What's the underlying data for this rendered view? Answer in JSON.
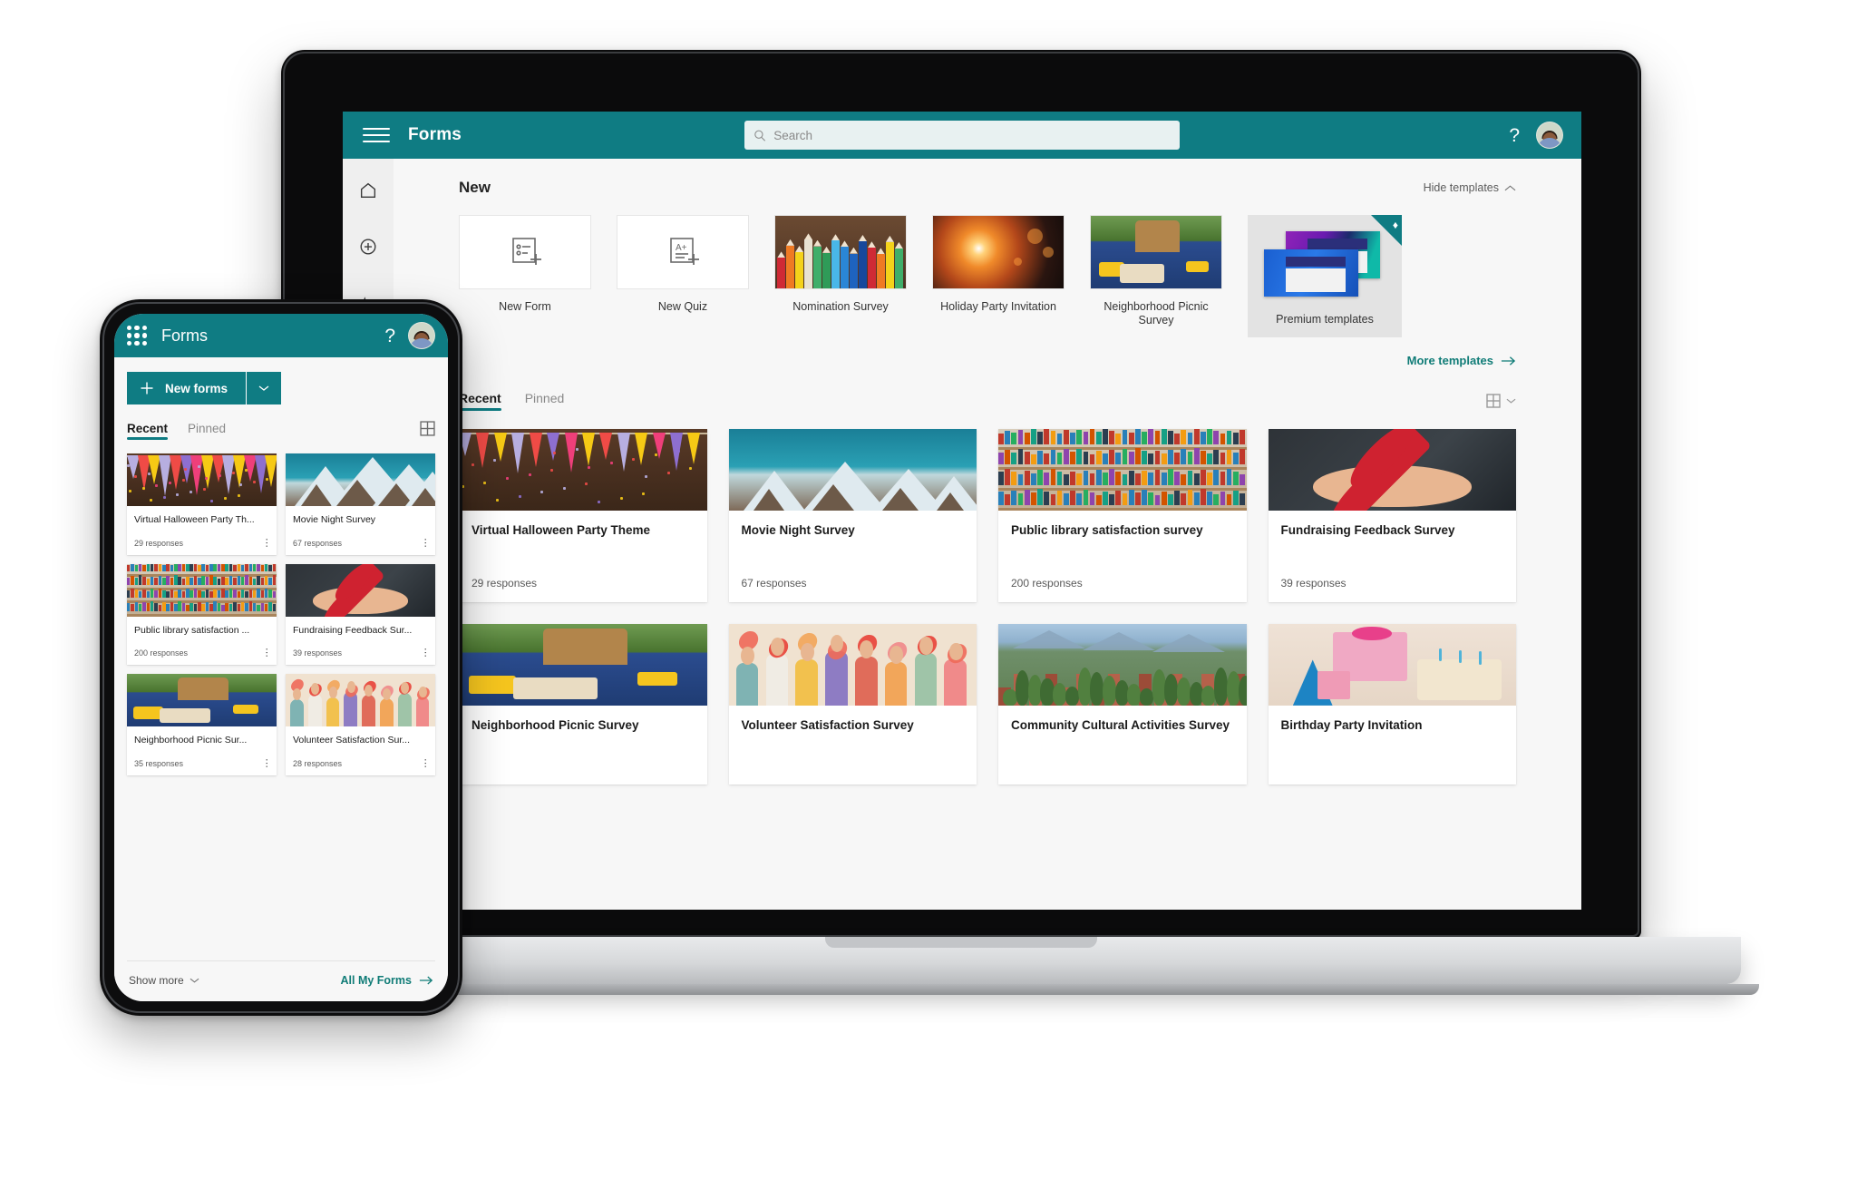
{
  "desktop": {
    "topbar": {
      "menu_icon": "hamburger-icon",
      "brand": "Forms",
      "search_placeholder": "Search",
      "search_value": "",
      "search_icon": "search-icon",
      "help_label": "?",
      "avatar_label": "Account manager"
    },
    "rail": [
      {
        "icon": "home-icon",
        "label": "Home"
      },
      {
        "icon": "plus-circle-icon",
        "label": "New"
      },
      {
        "icon": "activity-pulse-icon",
        "label": "Activity"
      }
    ],
    "new_section": {
      "title": "New",
      "hide_templates_label": "Hide templates",
      "hide_templates_icon": "chevron-up-icon",
      "more_templates_label": "More templates",
      "more_templates_icon": "arrow-right-icon",
      "templates": [
        {
          "label": "New Form",
          "art": "newform",
          "premium": false
        },
        {
          "label": "New Quiz",
          "art": "newquiz",
          "premium": false
        },
        {
          "label": "Nomination Survey",
          "art": "pencils",
          "premium": false
        },
        {
          "label": "Holiday Party Invitation",
          "art": "spark",
          "premium": false
        },
        {
          "label": "Neighborhood Picnic Survey",
          "art": "picnic",
          "premium": false
        },
        {
          "label": "Premium templates",
          "art": "premium",
          "premium": true,
          "badge_icon": "diamond-icon"
        }
      ]
    },
    "recent_section": {
      "tabs": [
        {
          "label": "Recent",
          "active": true
        },
        {
          "label": "Pinned",
          "active": false
        }
      ],
      "view_icon": "grid-view-icon",
      "view_caret_icon": "chevron-down-icon",
      "cards": [
        {
          "title": "Virtual Halloween Party Theme",
          "responses": "29 responses",
          "art": "flags"
        },
        {
          "title": "Movie Night Survey",
          "responses": "67 responses",
          "art": "mountain"
        },
        {
          "title": "Public library satisfaction survey",
          "responses": "200 responses",
          "art": "library"
        },
        {
          "title": "Fundraising Feedback Survey",
          "responses": "39 responses",
          "art": "heart"
        },
        {
          "title": "Neighborhood Picnic Survey",
          "responses": "",
          "art": "picnic"
        },
        {
          "title": "Volunteer Satisfaction Survey",
          "responses": "",
          "art": "volunteer"
        },
        {
          "title": "Community Cultural Activities Survey",
          "responses": "",
          "art": "city"
        },
        {
          "title": "Birthday Party Invitation",
          "responses": "",
          "art": "birthday"
        }
      ]
    }
  },
  "phone": {
    "topbar": {
      "waffle_icon": "app-launcher-icon",
      "brand": "Forms",
      "help_label": "?",
      "avatar_label": "Account manager"
    },
    "new_button": {
      "label": "New forms",
      "plus_icon": "plus-icon",
      "caret_icon": "chevron-down-icon"
    },
    "tabs": [
      {
        "label": "Recent",
        "active": true
      },
      {
        "label": "Pinned",
        "active": false
      }
    ],
    "view_icon": "grid-view-icon",
    "cards": [
      {
        "title": "Virtual Halloween Party Th...",
        "responses": "29 responses",
        "art": "flags",
        "more_icon": "more-vertical-icon"
      },
      {
        "title": "Movie Night Survey",
        "responses": "67 responses",
        "art": "mountain",
        "more_icon": "more-vertical-icon"
      },
      {
        "title": "Public library satisfaction ...",
        "responses": "200 responses",
        "art": "library",
        "more_icon": "more-vertical-icon"
      },
      {
        "title": "Fundraising Feedback Sur...",
        "responses": "39 responses",
        "art": "heart",
        "more_icon": "more-vertical-icon"
      },
      {
        "title": "Neighborhood Picnic Sur...",
        "responses": "35 responses",
        "art": "picnic",
        "more_icon": "more-vertical-icon"
      },
      {
        "title": "Volunteer Satisfaction Sur...",
        "responses": "28 responses",
        "art": "volunteer",
        "more_icon": "more-vertical-icon"
      }
    ],
    "footer": {
      "show_more_label": "Show more",
      "show_more_icon": "chevron-down-icon",
      "all_forms_label": "All My Forms",
      "all_forms_icon": "arrow-right-icon"
    }
  },
  "colors": {
    "brand_teal": "#0f7c83",
    "link_teal": "#107c77",
    "page_bg": "#f7f7f7",
    "rail_bg": "#efefef",
    "card_bg": "#ffffff"
  }
}
